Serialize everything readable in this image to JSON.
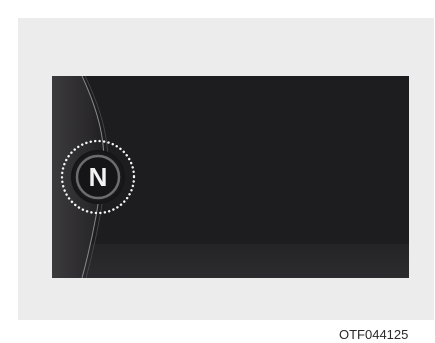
{
  "display": {
    "gear_indicator": "N",
    "gear_icon": "gear-position-indicator-icon",
    "highlight_icon": "dotted-highlight-ring-icon"
  },
  "figure": {
    "code": "OTF044125"
  },
  "colors": {
    "frame_background": "#ececec",
    "display_background": "#1d1c1e",
    "indicator_text": "#f2f2f2"
  }
}
